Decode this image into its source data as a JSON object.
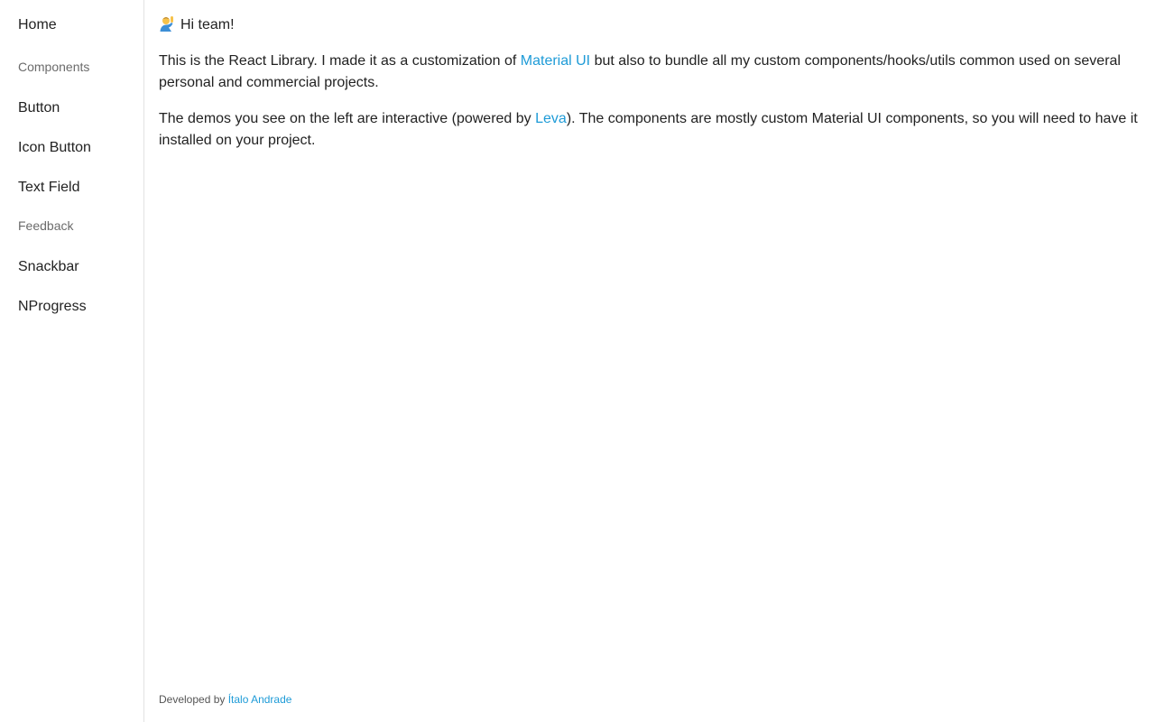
{
  "sidebar": {
    "home": "Home",
    "sections": [
      {
        "title": "Components",
        "items": [
          "Button",
          "Icon Button",
          "Text Field"
        ]
      },
      {
        "title": "Feedback",
        "items": [
          "Snackbar",
          "NProgress"
        ]
      }
    ]
  },
  "main": {
    "greeting": "Hi team!",
    "greeting_icon": "person-raising-hand-icon",
    "p1": {
      "before": "This is the React Library. I made it as a customization of ",
      "link": "Material UI",
      "after": " but also to bundle all my custom components/hooks/utils common used on several personal and commercial projects."
    },
    "p2": {
      "before": "The demos you see on the left are interactive (powered by ",
      "link": "Leva",
      "after": "). The components are mostly custom Material UI components, so you will need to have it installed on your project."
    }
  },
  "footer": {
    "prefix": "Developed by ",
    "author": "Ítalo Andrade"
  },
  "colors": {
    "link": "#1e9bd7",
    "section_label": "#6b6b6b",
    "border": "#e3e3e3"
  }
}
